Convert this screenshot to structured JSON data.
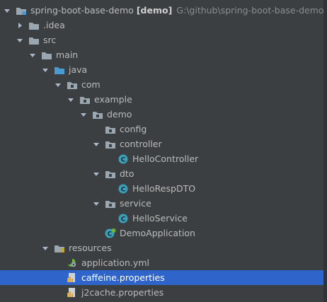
{
  "project": {
    "name": "spring-boot-base-demo",
    "module": "[demo]",
    "path": "G:\\github\\spring-boot-base-demo"
  },
  "tree": {
    "idea": ".idea",
    "src": "src",
    "main": "main",
    "java": "java",
    "com": "com",
    "example": "example",
    "demo": "demo",
    "config": "config",
    "controller": "controller",
    "hello_controller": "HelloController",
    "dto": "dto",
    "hello_resp_dto": "HelloRespDTO",
    "service": "service",
    "hello_service": "HelloService",
    "demo_application": "DemoApplication",
    "resources": "resources",
    "application_yml": "application.yml",
    "caffeine_properties": "caffeine.properties",
    "j2cache_properties": "j2cache.properties"
  },
  "colors": {
    "background": "#3c3f41",
    "selection": "#2f65ca",
    "folder": "#9aa7b0",
    "source_folder": "#4a9bd1",
    "class_icon": "#3aa0b8"
  }
}
